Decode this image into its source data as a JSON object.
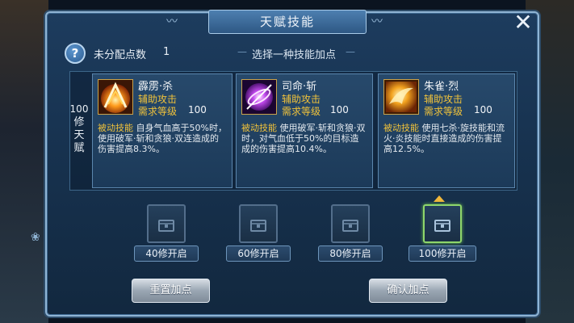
{
  "window": {
    "title": "天赋技能",
    "close_icon": "close-icon"
  },
  "info": {
    "help_icon_glyph": "?",
    "unassigned_label": "未分配点数",
    "unassigned_value": "1",
    "choose_hint": "选择一种技能加点"
  },
  "tier": {
    "number": "100",
    "label_chars": "修天赋"
  },
  "skills": [
    {
      "name": "霹雳·杀",
      "type": "辅助攻击",
      "req_label": "需求等级",
      "req_value": "100",
      "desc_keyword": "被动技能",
      "desc_text": "自身气血高于50%时，使用破军·斩和贪狼·双连造成的伤害提高8.3%。",
      "icon": "fire-slash-icon"
    },
    {
      "name": "司命·斩",
      "type": "辅助攻击",
      "req_label": "需求等级",
      "req_value": "100",
      "desc_keyword": "被动技能",
      "desc_text": "使用破军·斩和贪狼·双时，对气血低于50%的目标造成的伤害提高10.4%。",
      "icon": "purple-spiral-icon"
    },
    {
      "name": "朱雀·烈",
      "type": "辅助攻击",
      "req_label": "需求等级",
      "req_value": "100",
      "desc_keyword": "被动技能",
      "desc_text": "使用七杀·旋技能和流火·炎技能时直接造成的伤害提高12.5%。",
      "icon": "phoenix-icon"
    }
  ],
  "locks": [
    {
      "label": "40修开启",
      "active": false
    },
    {
      "label": "60修开启",
      "active": false
    },
    {
      "label": "80修开启",
      "active": false
    },
    {
      "label": "100修开启",
      "active": true
    }
  ],
  "buttons": {
    "reset": "重置加点",
    "confirm": "确认加点"
  },
  "colors": {
    "accent_gold": "#f0c23b",
    "panel_blue": "#1d3c5e",
    "active_green": "#8fd66b"
  }
}
